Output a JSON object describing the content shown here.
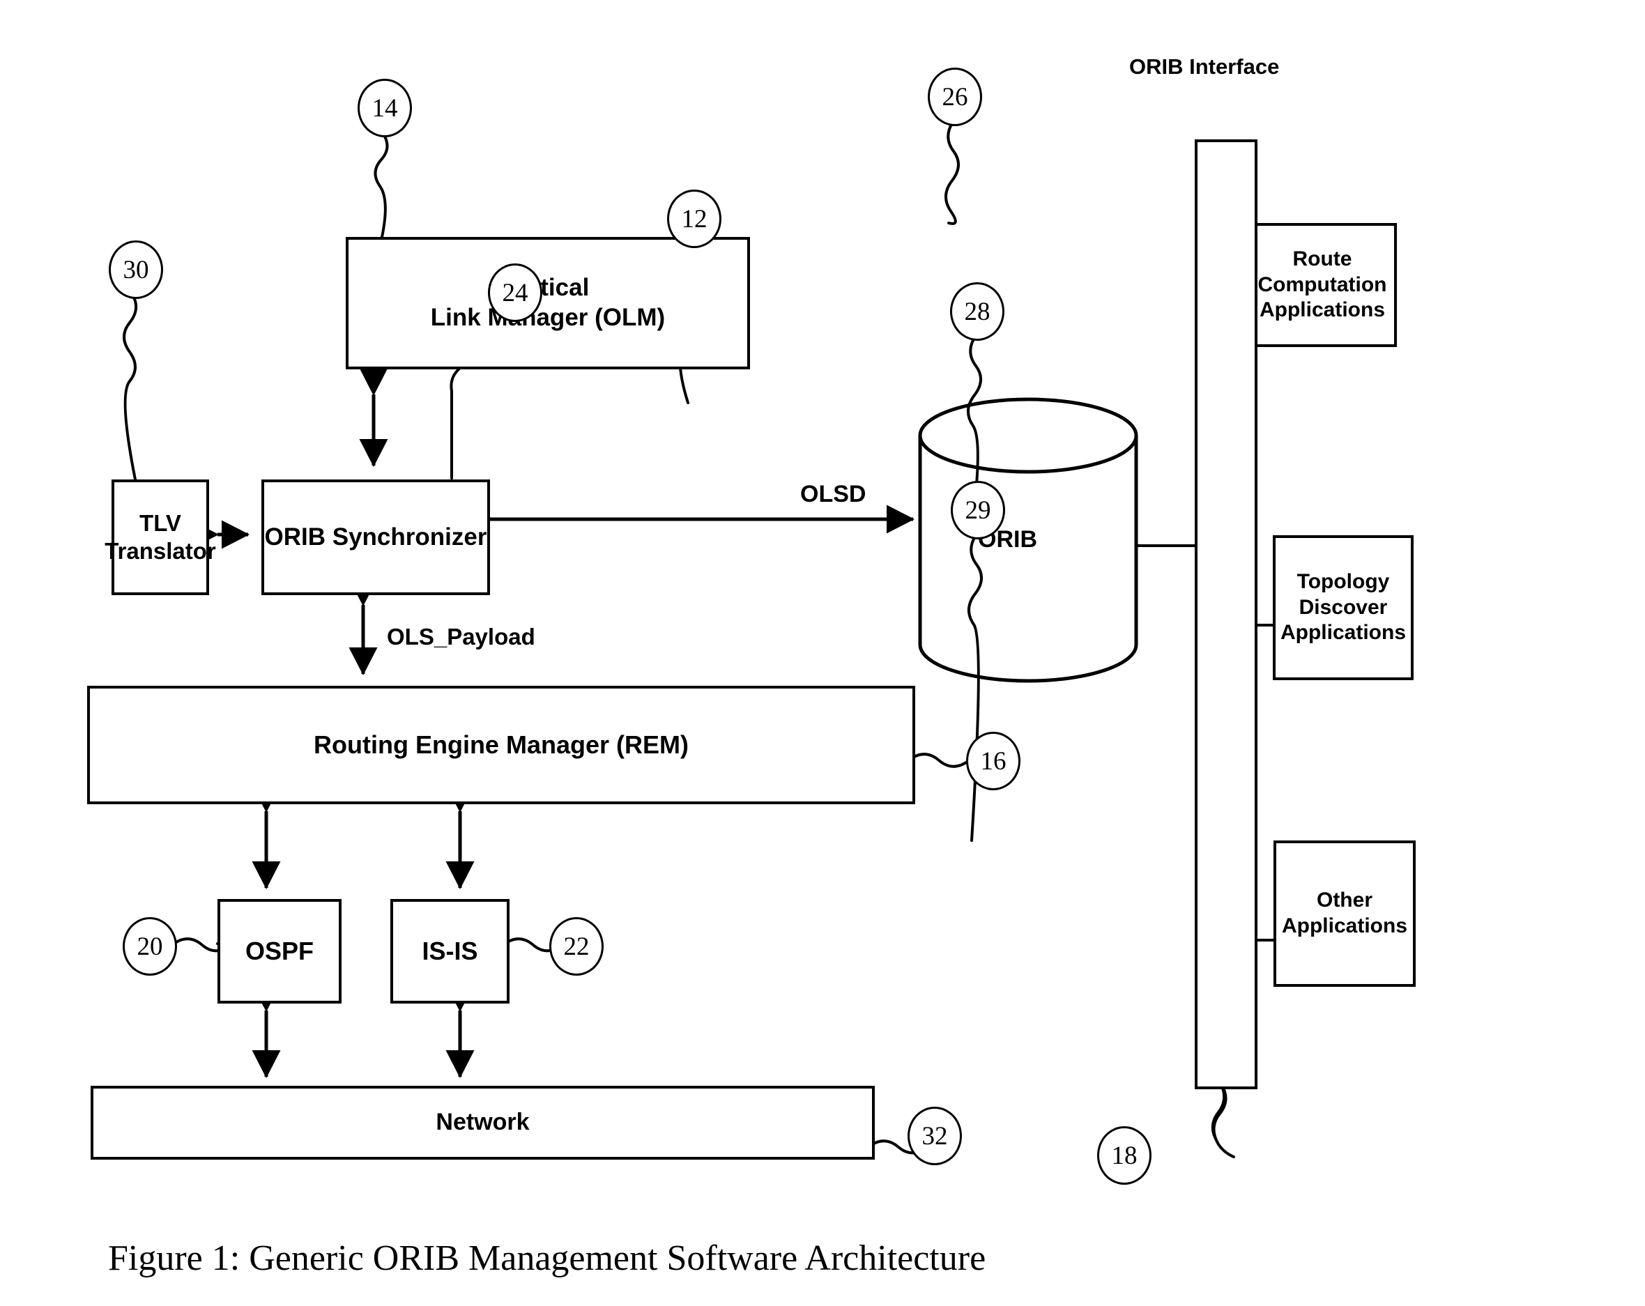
{
  "figure": {
    "caption": "Figure 1: Generic ORIB Management Software Architecture",
    "interface_label": "ORIB Interface"
  },
  "boxes": {
    "olm": {
      "label": "Optical\nLink  Manager (OLM)"
    },
    "tlv": {
      "label": "TLV\nTranslator"
    },
    "sync": {
      "label": "ORIB Synchronizer"
    },
    "rem": {
      "label": "Routing Engine Manager (REM)"
    },
    "ospf": {
      "label": "OSPF"
    },
    "isis": {
      "label": "IS-IS"
    },
    "network": {
      "label": "Network"
    },
    "route_computation": {
      "label": "Route\nComputation\nApplications"
    },
    "topology_discover": {
      "label": "Topology\nDiscover\nApplications"
    },
    "other_applications": {
      "label": "Other\nApplications"
    },
    "orib_db": {
      "label": "ORIB"
    }
  },
  "edge_labels": {
    "olsd": "OLSD",
    "ols_payload": "OLS_Payload"
  },
  "callouts": {
    "olm": "14",
    "tlv": "30",
    "sync": "24",
    "orib_db": "12",
    "rem": "16",
    "ospf": "20",
    "isis": "22",
    "network": "32",
    "route_computation": "26",
    "topology_discover": "28",
    "other_applications": "29",
    "orib_interface": "18"
  },
  "colors": {
    "stroke": "#000000",
    "background": "#ffffff"
  }
}
